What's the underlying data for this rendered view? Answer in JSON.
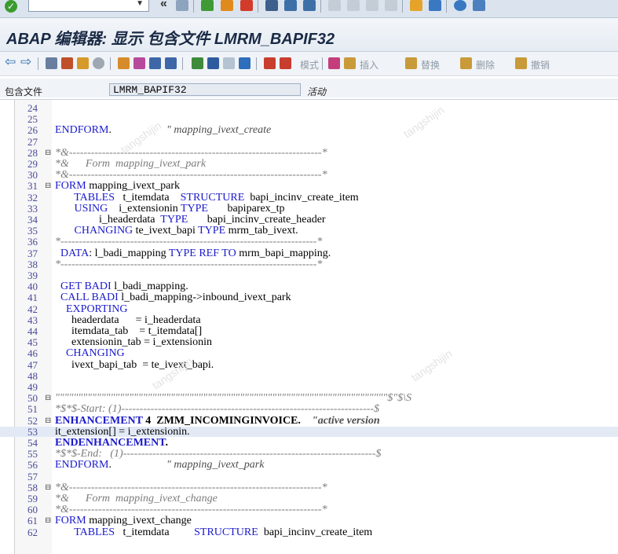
{
  "window": {
    "title": "ABAP 编辑器: 显示 包含文件 LMRM_BAPIF32"
  },
  "toolbar": {
    "mode_label": "模式",
    "insert_label": "插入",
    "replace_label": "替换",
    "delete_label": "删除",
    "undo_label": "撤销"
  },
  "include": {
    "label": "包含文件",
    "name": "LMRM_BAPIF32",
    "status": "活动"
  },
  "watermark": "tangshijin",
  "colors": {
    "keyword": "#1a1acc",
    "comment": "#7b7b7b",
    "highlight": "#e3eaf6"
  },
  "lines": [
    {
      "n": "24",
      "t": ""
    },
    {
      "n": "25",
      "t": ""
    },
    {
      "n": "26",
      "t": "ENDFORM.                    \" mapping_ivext_create"
    },
    {
      "n": "27",
      "t": ""
    },
    {
      "n": "28",
      "t": "*&---------------------------------------------------------------------*"
    },
    {
      "n": "29",
      "t": "*&      Form  mapping_ivext_park"
    },
    {
      "n": "30",
      "t": "*&---------------------------------------------------------------------*"
    },
    {
      "n": "31",
      "t": "FORM mapping_ivext_park"
    },
    {
      "n": "32",
      "t": "       TABLES   t_itemdata    STRUCTURE  bapi_incinv_create_item"
    },
    {
      "n": "33",
      "t": "       USING    i_extensionin TYPE       bapiparex_tp"
    },
    {
      "n": "34",
      "t": "                i_headerdata  TYPE       bapi_incinv_create_header"
    },
    {
      "n": "35",
      "t": "       CHANGING te_ivext_bapi TYPE mrm_tab_ivext."
    },
    {
      "n": "36",
      "t": "*----------------------------------------------------------------------*"
    },
    {
      "n": "37",
      "t": "  DATA: l_badi_mapping TYPE REF TO mrm_bapi_mapping."
    },
    {
      "n": "38",
      "t": "*----------------------------------------------------------------------*"
    },
    {
      "n": "39",
      "t": ""
    },
    {
      "n": "40",
      "t": "  GET BADI l_badi_mapping."
    },
    {
      "n": "41",
      "t": "  CALL BADI l_badi_mapping->inbound_ivext_park"
    },
    {
      "n": "42",
      "t": "    EXPORTING"
    },
    {
      "n": "43",
      "t": "      headerdata      = i_headerdata"
    },
    {
      "n": "44",
      "t": "      itemdata_tab    = t_itemdata[]"
    },
    {
      "n": "45",
      "t": "      extensionin_tab = i_extensionin"
    },
    {
      "n": "46",
      "t": "    CHANGING"
    },
    {
      "n": "47",
      "t": "      ivext_bapi_tab  = te_ivext_bapi."
    },
    {
      "n": "48",
      "t": ""
    },
    {
      "n": "49",
      "t": ""
    },
    {
      "n": "50",
      "t": "\"\"\"\"\"\"\"\"\"\"\"\"\"\"\"\"\"\"\"\"\"\"\"\"\"\"\"\"\"\"\"\"\"\"\"\"\"\"\"\"\"\"\"\"\"\"\"\"\"\"\"\"\"\"\"\"\"\"\"\"\"\"\"\"\"\"\"\"\"\"\"\"$\"$\\S"
    },
    {
      "n": "51",
      "t": "*$*$-Start: (1)---------------------------------------------------------------------$"
    },
    {
      "n": "52",
      "t": "ENHANCEMENT 4  ZMM_INCOMINGINVOICE.    \"active version"
    },
    {
      "n": "53",
      "t": "it_extension[] = i_extensionin."
    },
    {
      "n": "54",
      "t": "ENDENHANCEMENT."
    },
    {
      "n": "55",
      "t": "*$*$-End:   (1)---------------------------------------------------------------------$"
    },
    {
      "n": "56",
      "t": "ENDFORM.                    \" mapping_ivext_park"
    },
    {
      "n": "57",
      "t": ""
    },
    {
      "n": "58",
      "t": "*&---------------------------------------------------------------------*"
    },
    {
      "n": "59",
      "t": "*&      Form  mapping_ivext_change"
    },
    {
      "n": "60",
      "t": "*&---------------------------------------------------------------------*"
    },
    {
      "n": "61",
      "t": "FORM mapping_ivext_change"
    },
    {
      "n": "62",
      "t": "       TABLES   t_itemdata         STRUCTURE  bapi_incinv_create_item"
    }
  ]
}
